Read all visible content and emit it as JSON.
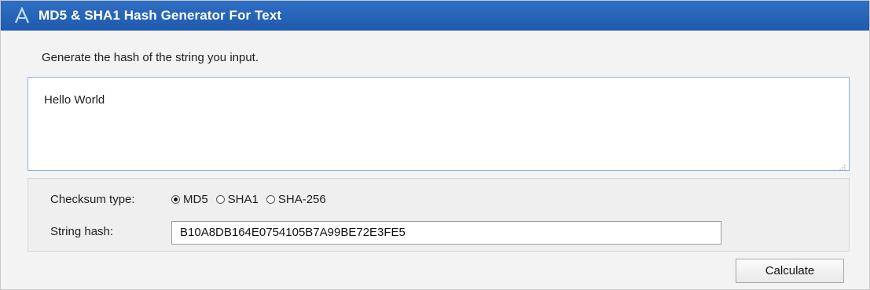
{
  "window": {
    "title": "MD5 & SHA1 Hash Generator For Text",
    "icon": "app-logo-icon"
  },
  "intro_text": "Generate the hash of the string you input.",
  "input": {
    "value": "Hello World"
  },
  "checksum": {
    "label": "Checksum type:",
    "options": [
      {
        "label": "MD5",
        "checked": true
      },
      {
        "label": "SHA1",
        "checked": false
      },
      {
        "label": "SHA-256",
        "checked": false
      }
    ]
  },
  "hash": {
    "label": "String hash:",
    "value": "B10A8DB164E0754105B7A99BE72E3FE5"
  },
  "actions": {
    "calculate_label": "Calculate"
  },
  "colors": {
    "titlebar": "#2063b8",
    "textarea_border": "#8fb0d4"
  }
}
